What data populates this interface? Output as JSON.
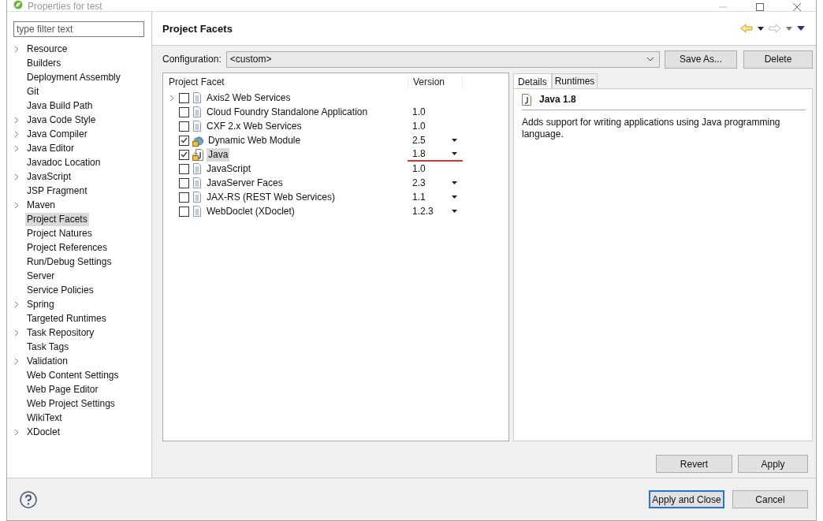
{
  "window": {
    "title": "Properties for test"
  },
  "sidebar": {
    "filter": {
      "placeholder": "type filter text"
    },
    "items": [
      {
        "label": "Resource",
        "expandable": true,
        "selected": false
      },
      {
        "label": "Builders",
        "expandable": false,
        "selected": false
      },
      {
        "label": "Deployment Assembly",
        "expandable": false,
        "selected": false
      },
      {
        "label": "Git",
        "expandable": false,
        "selected": false
      },
      {
        "label": "Java Build Path",
        "expandable": false,
        "selected": false
      },
      {
        "label": "Java Code Style",
        "expandable": true,
        "selected": false
      },
      {
        "label": "Java Compiler",
        "expandable": true,
        "selected": false
      },
      {
        "label": "Java Editor",
        "expandable": true,
        "selected": false
      },
      {
        "label": "Javadoc Location",
        "expandable": false,
        "selected": false
      },
      {
        "label": "JavaScript",
        "expandable": true,
        "selected": false
      },
      {
        "label": "JSP Fragment",
        "expandable": false,
        "selected": false
      },
      {
        "label": "Maven",
        "expandable": true,
        "selected": false
      },
      {
        "label": "Project Facets",
        "expandable": false,
        "selected": true
      },
      {
        "label": "Project Natures",
        "expandable": false,
        "selected": false
      },
      {
        "label": "Project References",
        "expandable": false,
        "selected": false
      },
      {
        "label": "Run/Debug Settings",
        "expandable": false,
        "selected": false
      },
      {
        "label": "Server",
        "expandable": false,
        "selected": false
      },
      {
        "label": "Service Policies",
        "expandable": false,
        "selected": false
      },
      {
        "label": "Spring",
        "expandable": true,
        "selected": false
      },
      {
        "label": "Targeted Runtimes",
        "expandable": false,
        "selected": false
      },
      {
        "label": "Task Repository",
        "expandable": true,
        "selected": false
      },
      {
        "label": "Task Tags",
        "expandable": false,
        "selected": false
      },
      {
        "label": "Validation",
        "expandable": true,
        "selected": false
      },
      {
        "label": "Web Content Settings",
        "expandable": false,
        "selected": false
      },
      {
        "label": "Web Page Editor",
        "expandable": false,
        "selected": false
      },
      {
        "label": "Web Project Settings",
        "expandable": false,
        "selected": false
      },
      {
        "label": "WikiText",
        "expandable": false,
        "selected": false
      },
      {
        "label": "XDoclet",
        "expandable": true,
        "selected": false
      }
    ]
  },
  "page": {
    "title": "Project Facets",
    "configuration": {
      "label": "Configuration:",
      "value": "<custom>"
    },
    "buttons": [
      "Save As...",
      "Delete"
    ]
  },
  "facets": {
    "columns": [
      "Project Facet",
      "Version"
    ],
    "rows": [
      {
        "name": "Axis2 Web Services",
        "kind": "doc",
        "expandable": true,
        "checked": false,
        "selected": false,
        "dropdown": false,
        "underlined": false
      },
      {
        "name": "Cloud Foundry Standalone Application",
        "version": "1.0",
        "kind": "doc",
        "expandable": false,
        "checked": false,
        "selected": false,
        "dropdown": false,
        "underlined": false
      },
      {
        "name": "CXF 2.x Web Services",
        "version": "1.0",
        "kind": "doc",
        "expandable": false,
        "checked": false,
        "selected": false,
        "dropdown": false,
        "underlined": false
      },
      {
        "name": "Dynamic Web Module",
        "version": "2.5",
        "kind": "web",
        "expandable": false,
        "checked": true,
        "selected": false,
        "dropdown": true,
        "underlined": false
      },
      {
        "name": "Java",
        "version": "1.8",
        "kind": "java",
        "expandable": false,
        "checked": true,
        "selected": true,
        "dropdown": true,
        "underlined": true
      },
      {
        "name": "JavaScript",
        "version": "1.0",
        "kind": "doc",
        "expandable": false,
        "checked": false,
        "selected": false,
        "dropdown": false,
        "underlined": false
      },
      {
        "name": "JavaServer Faces",
        "version": "2.3",
        "kind": "doc",
        "expandable": false,
        "checked": false,
        "selected": false,
        "dropdown": true,
        "underlined": false
      },
      {
        "name": "JAX-RS (REST Web Services)",
        "version": "1.1",
        "kind": "doc",
        "expandable": false,
        "checked": false,
        "selected": false,
        "dropdown": true,
        "underlined": false
      },
      {
        "name": "WebDoclet (XDoclet)",
        "version": "1.2.3",
        "kind": "doc",
        "expandable": false,
        "checked": false,
        "selected": false,
        "dropdown": true,
        "underlined": false
      }
    ]
  },
  "details": {
    "tabs": [
      {
        "label": "Details",
        "selected": true
      },
      {
        "label": "Runtimes",
        "selected": false
      }
    ],
    "heading": "Java 1.8",
    "description": "Adds support for writing applications using Java programming language."
  },
  "page_buttons": [
    "Revert",
    "Apply"
  ],
  "footer_buttons": [
    {
      "label": "Apply and Close",
      "default": true
    },
    {
      "label": "Cancel",
      "default": false
    }
  ]
}
